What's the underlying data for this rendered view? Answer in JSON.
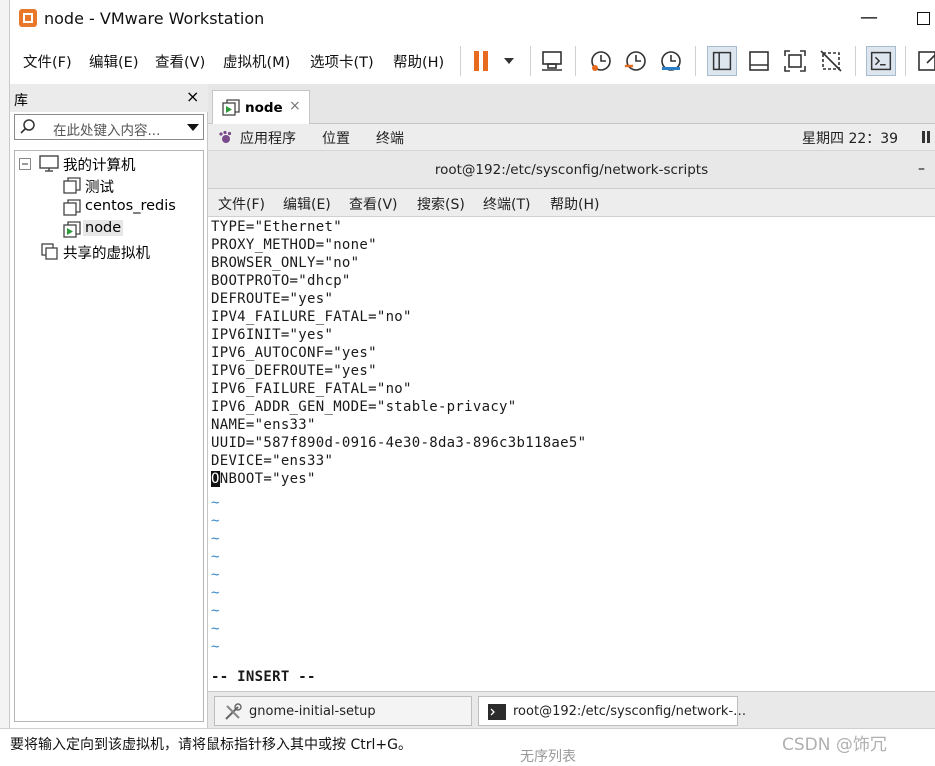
{
  "window": {
    "title": "node - VMware Workstation",
    "minimize_label": "—"
  },
  "menubar": {
    "items": [
      "文件(F)",
      "编辑(E)",
      "查看(V)",
      "虚拟机(M)",
      "选项卡(T)",
      "帮助(H)"
    ]
  },
  "sidebar": {
    "title": "库",
    "close": "×",
    "search_placeholder": "在此处键入内容...",
    "tree": [
      {
        "label": "我的计算机",
        "type": "computer"
      },
      {
        "label": "测试",
        "type": "vm"
      },
      {
        "label": "centos_redis",
        "type": "vm"
      },
      {
        "label": "node",
        "type": "vm-running",
        "selected": true
      },
      {
        "label": "共享的虚拟机",
        "type": "shared"
      }
    ]
  },
  "tabs": [
    {
      "label": "node",
      "close": "×",
      "active": true
    }
  ],
  "guest": {
    "top_bar": {
      "apps": "应用程序",
      "places": "位置",
      "terminal": "终端",
      "clock": "星期四 22：39"
    },
    "terminal_window": {
      "title": "root@192:/etc/sysconfig/network-scripts",
      "minimize": "–",
      "menu": [
        "文件(F)",
        "编辑(E)",
        "查看(V)",
        "搜索(S)",
        "终端(T)",
        "帮助(H)"
      ],
      "lines": [
        "TYPE=\"Ethernet\"",
        "PROXY_METHOD=\"none\"",
        "BROWSER_ONLY=\"no\"",
        "BOOTPROTO=\"dhcp\"",
        "DEFROUTE=\"yes\"",
        "IPV4_FAILURE_FATAL=\"no\"",
        "IPV6INIT=\"yes\"",
        "IPV6_AUTOCONF=\"yes\"",
        "IPV6_DEFROUTE=\"yes\"",
        "IPV6_FAILURE_FATAL=\"no\"",
        "IPV6_ADDR_GEN_MODE=\"stable-privacy\"",
        "NAME=\"ens33\"",
        "UUID=\"587f890d-0916-4e30-8da3-896c3b118ae5\"",
        "DEVICE=\"ens33\""
      ],
      "cursor_line": {
        "cursor_char": "O",
        "rest": "NBOOT=\"yes\""
      },
      "tilde": "~",
      "tilde_count": 9,
      "mode": "-- INSERT --"
    },
    "taskbar": [
      {
        "label": "gnome-initial-setup",
        "active": false
      },
      {
        "label": "root@192:/etc/sysconfig/network-…",
        "active": true
      }
    ]
  },
  "statusbar": {
    "text": "要将输入定向到该虚拟机，请将鼠标指针移入其中或按 Ctrl+G。"
  },
  "background": {
    "under_text": "无序列表",
    "watermark": "CSDN @饰冗"
  },
  "colors": {
    "pause_orange": "#e86a1e",
    "tilde_blue": "#3b86c7",
    "vm_green": "#2d9b3a"
  }
}
